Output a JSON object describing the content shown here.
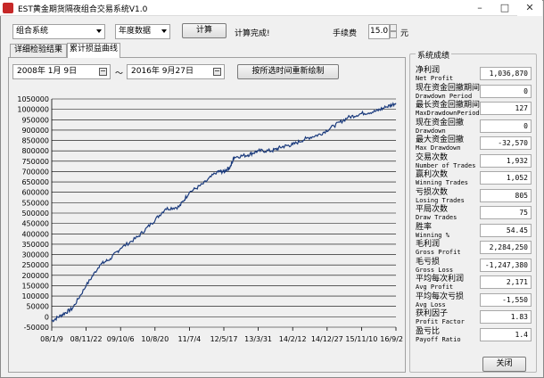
{
  "window": {
    "title": "EST黄金期货隔夜组合交易系统V1.0"
  },
  "toolbar": {
    "portfolio_combo": "组合系统",
    "data_combo": "年度数据",
    "compute_button": "计算",
    "status_text": "计算完成!",
    "fee_label": "手续费",
    "fee_value": "15.0",
    "fee_unit": "元"
  },
  "tabs": [
    {
      "label": "详细检验结果"
    },
    {
      "label": "累计损益曲线"
    }
  ],
  "date_range": {
    "start": "2008年  1月  9日",
    "separator": "～",
    "end": "2016年  9月27日",
    "redraw_button": "按所选时间重新绘制"
  },
  "chart_data": {
    "type": "line",
    "title": "",
    "xlabel": "",
    "ylabel": "",
    "ylim": [
      -50000,
      1050000
    ],
    "yticks": [
      "1050000",
      "1000000",
      "950000",
      "900000",
      "850000",
      "800000",
      "750000",
      "700000",
      "650000",
      "600000",
      "550000",
      "500000",
      "450000",
      "400000",
      "350000",
      "300000",
      "250000",
      "200000",
      "150000",
      "100000",
      "50000",
      "0",
      "-50000"
    ],
    "xticks": [
      "08/1/9",
      "08/11/22",
      "09/10/6",
      "10/8/20",
      "11/7/4",
      "12/5/17",
      "13/3/31",
      "14/2/12",
      "14/12/27",
      "15/11/10",
      "16/9/2"
    ],
    "grid": true,
    "line_color": "#1a3a7c",
    "series": [
      {
        "x": [
          0,
          0.3,
          0.6,
          1.0,
          1.4,
          1.7,
          2.0,
          2.5,
          2.9,
          3.3,
          3.7,
          4.0,
          4.4,
          4.8,
          5.0,
          5.2,
          5.3,
          5.7,
          6.0,
          6.4,
          6.7,
          7.0,
          7.4,
          7.8,
          8.2,
          8.6,
          9.0,
          9.4,
          9.7,
          10.0
        ],
        "values": [
          -20000,
          10000,
          40000,
          150000,
          250000,
          280000,
          330000,
          385000,
          450000,
          520000,
          530000,
          600000,
          640000,
          700000,
          700000,
          725000,
          770000,
          780000,
          800000,
          800000,
          820000,
          830000,
          860000,
          880000,
          920000,
          960000,
          980000,
          990000,
          1010000,
          1030000
        ]
      }
    ]
  },
  "stats_panel": {
    "title": "系统成绩",
    "items": [
      {
        "cn": "净利润",
        "en": "Net Profit",
        "value": "1,036,870"
      },
      {
        "cn": "现在资金回撤期间",
        "en": "Drawdown Period",
        "value": "0"
      },
      {
        "cn": "最长资金回撤期间",
        "en": "MaxDrawdownPeriod",
        "value": "127"
      },
      {
        "cn": "现在资金回撤",
        "en": "Drawdown",
        "value": "0"
      },
      {
        "cn": "最大资金回撤",
        "en": "Max Drawdown",
        "value": "-32,570"
      },
      {
        "cn": "交易次数",
        "en": "Number of Trades",
        "value": "1,932"
      },
      {
        "cn": "赢利次数",
        "en": "Winning Trades",
        "value": "1,052"
      },
      {
        "cn": "亏损次数",
        "en": "Losing Trades",
        "value": "805"
      },
      {
        "cn": "平局次数",
        "en": "Draw Trades",
        "value": "75"
      },
      {
        "cn": "胜率",
        "en": "Winning %",
        "value": "54.45"
      },
      {
        "cn": "毛利润",
        "en": "Gross Profit",
        "value": "2,284,250"
      },
      {
        "cn": "毛亏损",
        "en": "Gross Loss",
        "value": "-1,247,380"
      },
      {
        "cn": "平均每次利润",
        "en": "Avg Profit",
        "value": "2,171"
      },
      {
        "cn": "平均每次亏损",
        "en": "Avg Loss",
        "value": "-1,550"
      },
      {
        "cn": "获利因子",
        "en": "Profit Factor",
        "value": "1.83"
      },
      {
        "cn": "盈亏比",
        "en": "Payoff Ratio",
        "value": "1.4"
      }
    ],
    "close_button": "关闭"
  }
}
